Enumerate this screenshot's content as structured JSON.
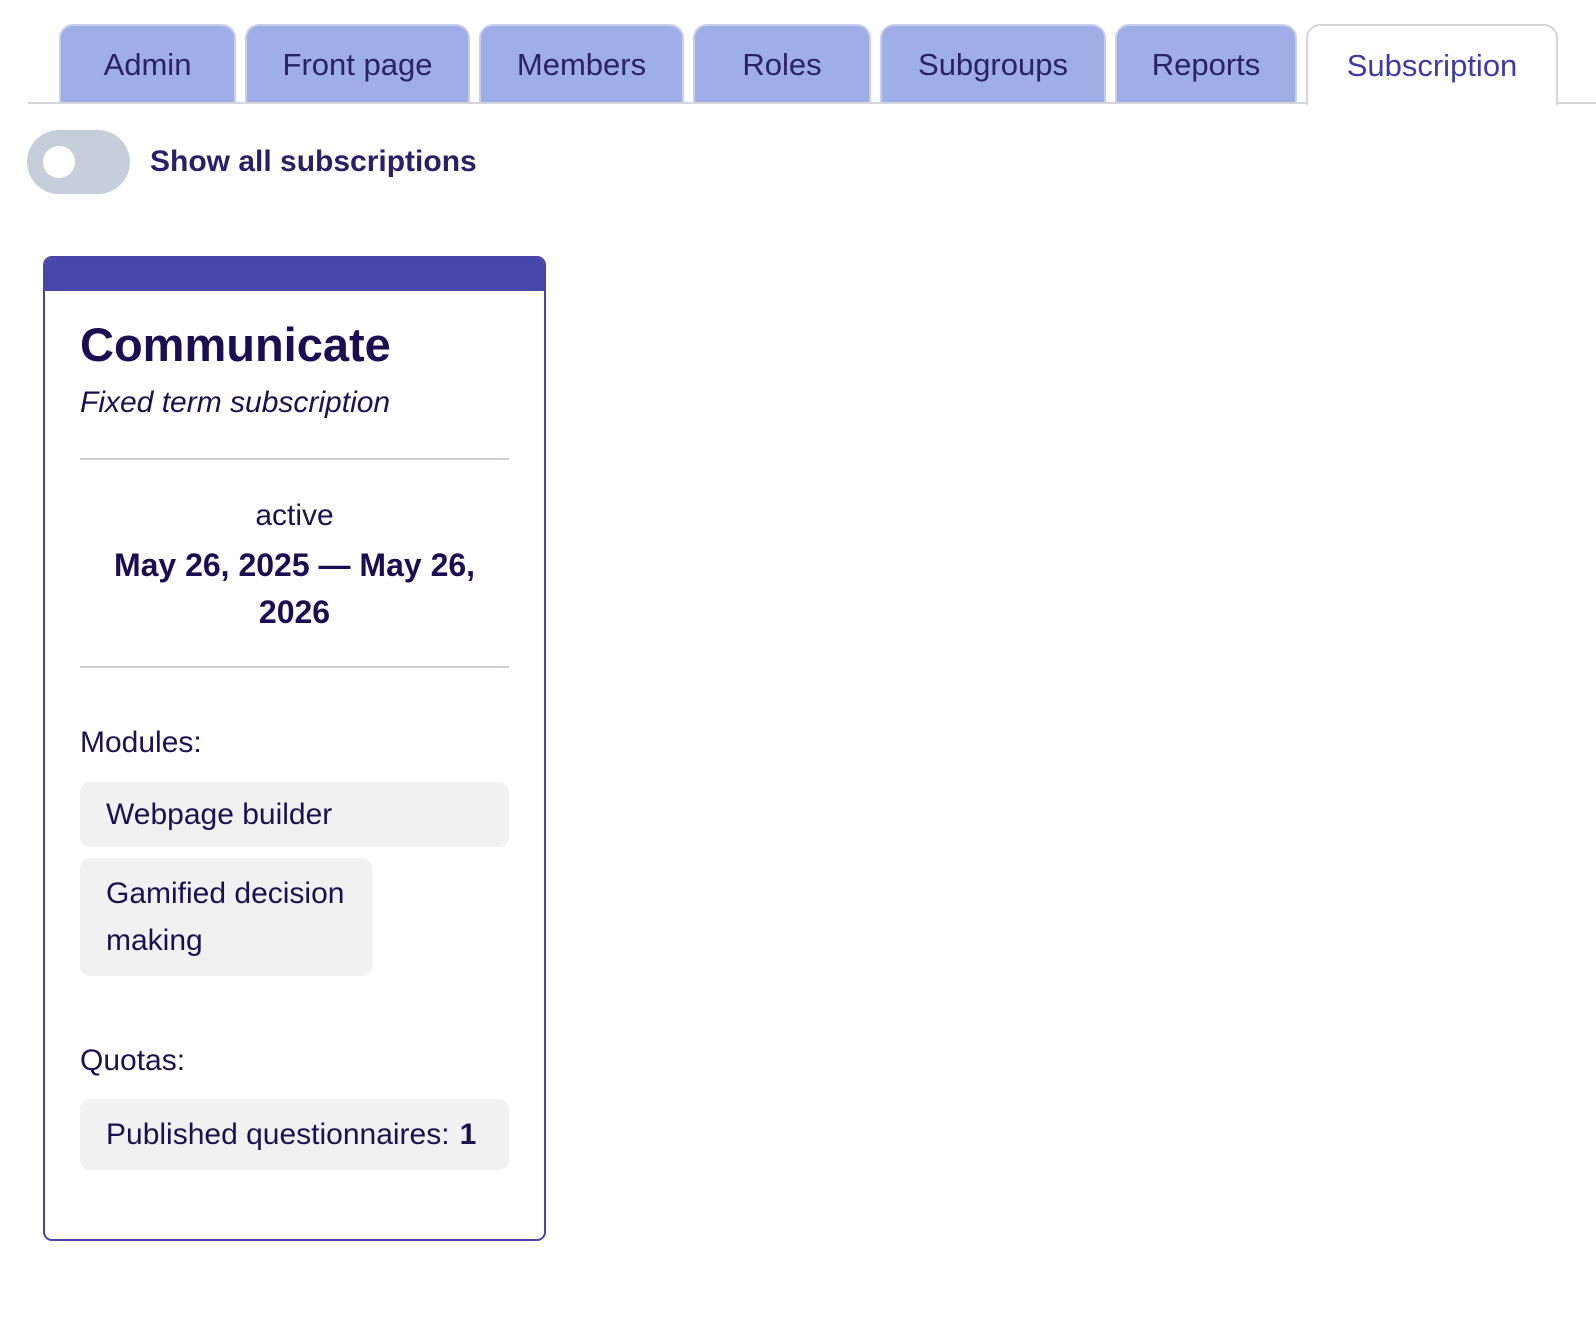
{
  "tabs": [
    {
      "label": "Admin",
      "active": false
    },
    {
      "label": "Front page",
      "active": false
    },
    {
      "label": "Members",
      "active": false
    },
    {
      "label": "Roles",
      "active": false
    },
    {
      "label": "Subgroups",
      "active": false
    },
    {
      "label": "Reports",
      "active": false
    },
    {
      "label": "Subscription",
      "active": true
    }
  ],
  "toggle": {
    "label": "Show all subscriptions",
    "checked": false
  },
  "subscription": {
    "title": "Communicate",
    "type": "Fixed term subscription",
    "status": "active",
    "date_range": "May 26, 2025 — May 26, 2026",
    "modules_label": "Modules:",
    "modules": [
      "Webpage builder",
      "Gamified decision making"
    ],
    "quotas_label": "Quotas:",
    "quotas": [
      {
        "label": "Published questionnaires:",
        "value": "1"
      }
    ]
  },
  "colors": {
    "tab_bg": "#a0aee8",
    "active_tab_text": "#3f3aa6",
    "card_accent": "#4646ab",
    "text_dark": "#1b0d52",
    "toggle_off": "#c6cfd9",
    "pill_bg": "#f1f1f1"
  }
}
